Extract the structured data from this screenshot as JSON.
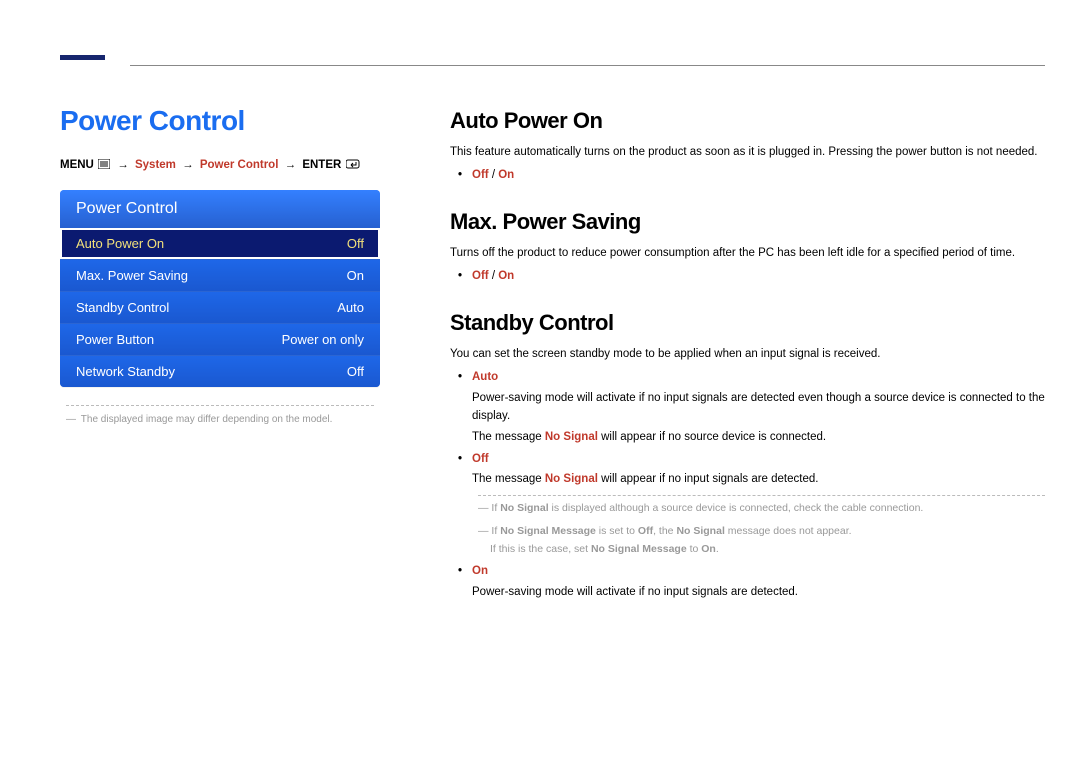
{
  "page_title": "Power Control",
  "breadcrumb": {
    "menu": "MENU",
    "system": "System",
    "power_control": "Power Control",
    "enter": "ENTER"
  },
  "panel": {
    "header": "Power Control",
    "rows": [
      {
        "label": "Auto Power On",
        "value": "Off",
        "selected": true
      },
      {
        "label": "Max. Power Saving",
        "value": "On",
        "selected": false
      },
      {
        "label": "Standby Control",
        "value": "Auto",
        "selected": false
      },
      {
        "label": "Power Button",
        "value": "Power on only",
        "selected": false
      },
      {
        "label": "Network Standby",
        "value": "Off",
        "selected": false
      }
    ]
  },
  "footnote": "The displayed image may differ depending on the model.",
  "sections": {
    "auto_power": {
      "title": "Auto Power On",
      "desc": "This feature automatically turns on the product as soon as it is plugged in. Pressing the power button is not needed.",
      "opt_off": "Off",
      "opt_on": "On"
    },
    "max_power": {
      "title": "Max. Power Saving",
      "desc": "Turns off the product to reduce power consumption after the PC has been left idle for a specified period of time.",
      "opt_off": "Off",
      "opt_on": "On"
    },
    "standby": {
      "title": "Standby Control",
      "desc": "You can set the screen standby mode to be applied when an input signal is received.",
      "auto_label": "Auto",
      "auto_desc1": "Power-saving mode will activate if no input signals are detected even though a source device is connected to the display.",
      "auto_desc2_pre": "The message ",
      "auto_desc2_sig": "No Signal",
      "auto_desc2_post": " will appear if no source device is connected.",
      "off_label": "Off",
      "off_desc_pre": "The message ",
      "off_desc_sig": "No Signal",
      "off_desc_post": " will appear if no input signals are detected.",
      "note1_pre": "If ",
      "note1_sig": "No Signal",
      "note1_post": " is displayed although a source device is connected, check the cable connection.",
      "note2_a": "If ",
      "note2_b": "No Signal Message",
      "note2_c": " is set to ",
      "note2_d": "Off",
      "note2_e": ", the ",
      "note2_f": "No Signal",
      "note2_g": " message does not appear.",
      "note2_line2_a": "If this is the case, set ",
      "note2_line2_b": "No Signal Message",
      "note2_line2_c": " to ",
      "note2_line2_d": "On",
      "note2_line2_e": ".",
      "on_label": "On",
      "on_desc": "Power-saving mode will activate if no input signals are detected."
    }
  }
}
